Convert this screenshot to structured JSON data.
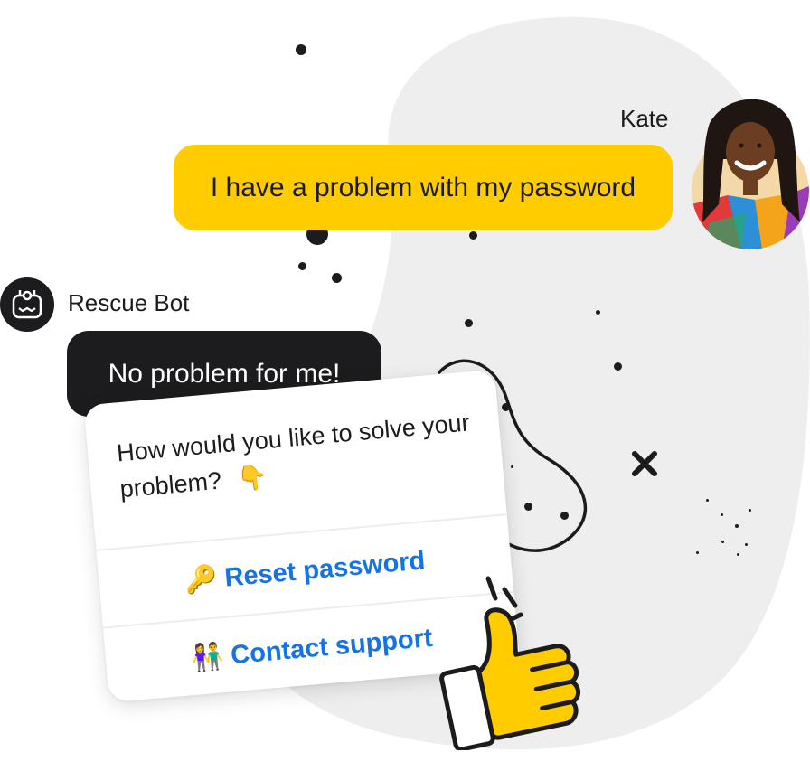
{
  "user": {
    "name": "Kate",
    "message": "I have a problem with my password"
  },
  "bot": {
    "name": "Rescue Bot",
    "message": "No problem for me!"
  },
  "card": {
    "question": "How would you like to solve your problem?",
    "options": [
      {
        "label": "Reset password",
        "icon": "key-icon"
      },
      {
        "label": "Contact support",
        "icon": "two-people-icon"
      }
    ]
  },
  "colors": {
    "accent_yellow": "#ffcc00",
    "dark": "#1c1c1e",
    "link_blue": "#1473e6",
    "blob_grey": "#eeeeee"
  }
}
